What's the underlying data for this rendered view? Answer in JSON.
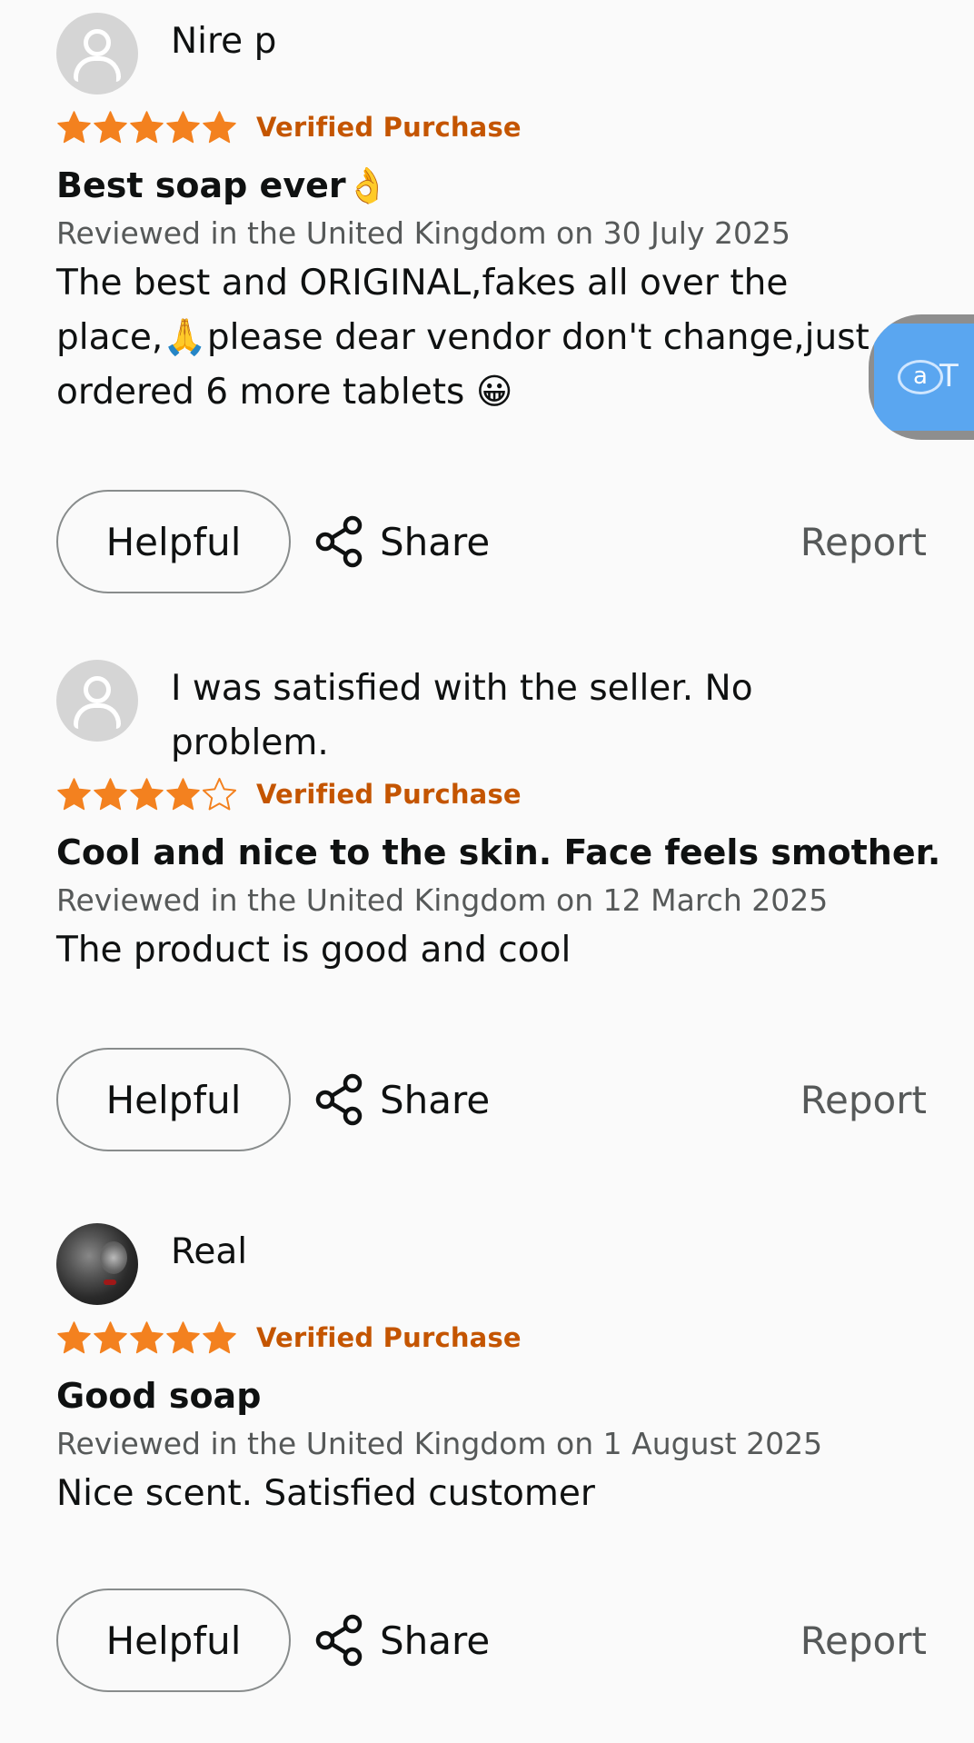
{
  "reviews": [
    {
      "reviewer": "Nire p",
      "avatar": "default-avatar",
      "rating": 5,
      "verified": "Verified Purchase",
      "title": "Best soap ever👌",
      "date": "Reviewed in the United Kingdom on 30 July 2025",
      "body": "The best and ORIGINAL,fakes all over the place,🙏please dear vendor don't change,just ordered 6 more tablets 😀",
      "helpful_label": "Helpful",
      "share_label": "Share",
      "report_label": "Report"
    },
    {
      "reviewer": "I was satisfied with the seller. No problem.",
      "avatar": "default-avatar",
      "rating": 4,
      "verified": "Verified Purchase",
      "title": "Cool and nice to the skin. Face feels smother.",
      "date": "Reviewed in the United Kingdom on 12 March 2025",
      "body": "The product is good and cool",
      "helpful_label": "Helpful",
      "share_label": "Share",
      "report_label": "Report"
    },
    {
      "reviewer": "Real",
      "avatar": "photo-avatar",
      "rating": 5,
      "verified": "Verified Purchase",
      "title": "Good soap",
      "date": "Reviewed in the United Kingdom on 1 August 2025",
      "body": "Nice scent. Satisfied customer",
      "helpful_label": "Helpful",
      "share_label": "Share",
      "report_label": "Report"
    }
  ],
  "colors": {
    "star": "#f3811f",
    "verified": "#c45500",
    "secondary_text": "#565959",
    "background": "#fafafa"
  },
  "icons": {
    "share": "share-icon",
    "translate": "translate-icon"
  }
}
